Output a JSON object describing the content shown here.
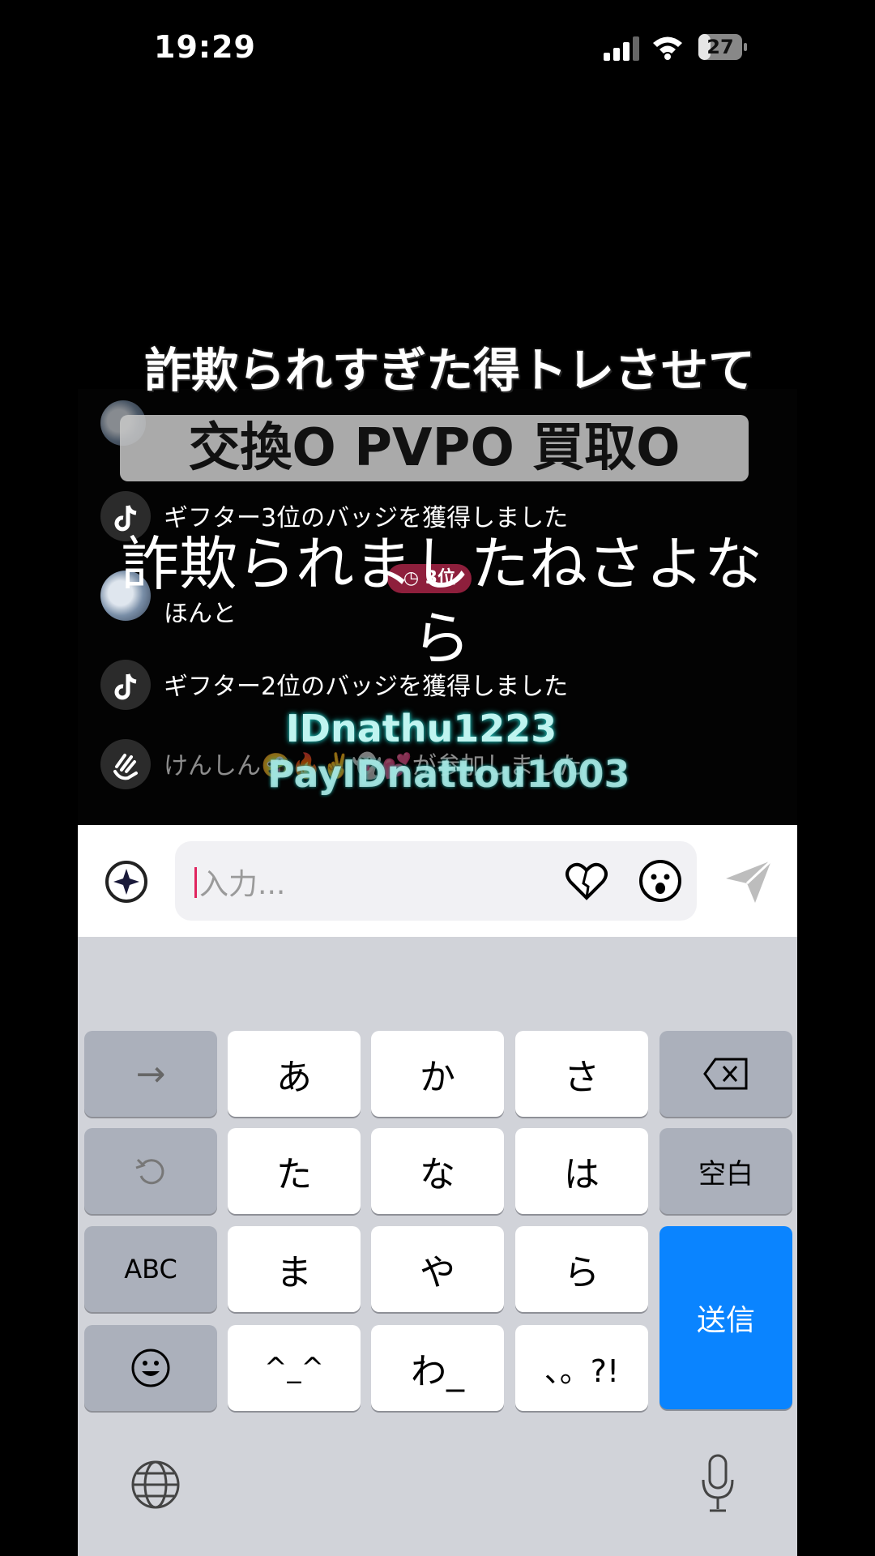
{
  "status_bar": {
    "time": "19:29",
    "battery": "27",
    "battery_level": 0.27
  },
  "video": {
    "title": "詐欺られすぎた得トレさせて",
    "banner": "交換O PVPO 買取O",
    "caption": "詐欺られましたねさよなら",
    "id_line1": "IDnathu1223",
    "id_line2": "PayIDnattou1003"
  },
  "chat": {
    "rows": [
      {
        "text": "ギフター3位のバッジを獲得しました"
      },
      {
        "text": "ほんと"
      },
      {
        "text": "ギフター2位のバッジを獲得しました"
      },
      {
        "text": "けんしん🤪🔥✌️👻💕が参加しました"
      }
    ],
    "rank_badge": "3位"
  },
  "input": {
    "placeholder": "入力..."
  },
  "keyboard": {
    "row1": [
      "→",
      "あ",
      "か",
      "さ"
    ],
    "row2": [
      "た",
      "な",
      "は",
      "空白"
    ],
    "row3": [
      "ABC",
      "ま",
      "や",
      "ら",
      "送信"
    ],
    "row4": [
      "^_^",
      "わ_",
      "、。?!"
    ]
  },
  "colors": {
    "send_key": "#0a84ff",
    "caret": "#e0245e",
    "badge": "#8e1f3c"
  }
}
